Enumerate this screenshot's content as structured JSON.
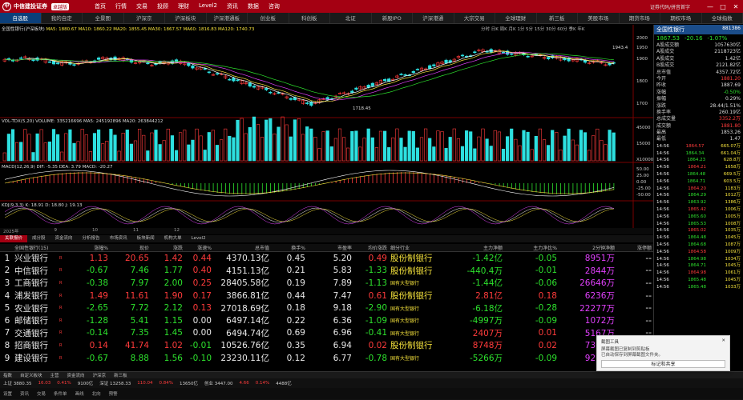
{
  "app": {
    "logo": "中信建投证券",
    "logo_sub": "CHINA SECURITIES",
    "edition": "卓越版",
    "menu": [
      "首页",
      "行情",
      "交易",
      "投顾",
      "理财",
      "Level2",
      "资讯",
      "数据",
      "咨询"
    ],
    "search": "证券代码/拼音首字"
  },
  "tabs": [
    "自选股",
    "我的自定",
    "全景图",
    "沪深京",
    "沪深板块",
    "沪深港通板",
    "创业板",
    "科创板",
    "北证",
    "新股IPO",
    "沪深港通",
    "大宗交易",
    "全球理财",
    "新三板",
    "美股市场",
    "期货市场",
    "期权市场",
    "全球指数"
  ],
  "chart": {
    "title": "全国性银行(沪深板块)",
    "ma_text": "MA5: 1880.67  MA10: 1860.22  MA20: 1855.45  MA30: 1867.57  MA60: 1816.83  MA120: 1740.73",
    "vol_text": "VOL-TDX(5,20) VOLUME: 335216696  MA5: 245192896  MA20: 263844212",
    "macd_text": "MACD(12,26,9) DIF: -5.35  DEA: 3.79  MACD: -20.27",
    "kdj_text": "KDJ(9,3,3) K: 18.91  D: 18.80  J: 19.13",
    "y_labels": [
      "2000",
      "1950",
      "1900",
      "1800",
      "1700"
    ],
    "vol_labels": [
      "45000",
      "15000",
      "X10000"
    ],
    "macd_labels": [
      "50.00",
      "25.00",
      "0.00",
      "-25.00",
      "-50.00"
    ],
    "x_labels": [
      "2025年",
      "9",
      "10",
      "11",
      "12"
    ],
    "low_label": "1718.45",
    "high_label": "1943.4",
    "toolbar": "分时  日K  周K  月K  1分  5分  15分  30分  60分  季K  年K"
  },
  "side": {
    "name": "全国性银行",
    "code": "881386",
    "price": "1867.53",
    "change": "-20.16",
    "pct": "-1.07%",
    "rows": [
      [
        "A股成交额",
        "1057630亿"
      ],
      [
        "A股成交",
        "2118723亿"
      ],
      [
        "A股成交",
        "1.42亿"
      ],
      [
        "B股成交",
        "2121.82亿"
      ],
      [
        "总市值",
        "4357.72亿"
      ],
      [
        "今开",
        "1881.20"
      ],
      [
        "昨收",
        "1887.69"
      ],
      [
        "涨幅",
        "-0.50%"
      ],
      [
        "振幅",
        "0.29%"
      ],
      [
        "涨跌",
        "28.44/1.51%"
      ],
      [
        "换手率",
        "260.19亿"
      ],
      [
        "总成交量",
        "3352.2万"
      ],
      [
        "成交额",
        "1881.80"
      ],
      [
        "最高",
        "1853.26"
      ],
      [
        "最低",
        "1.47"
      ]
    ],
    "ticks": [
      [
        "14:56",
        "1864.57",
        "665.07万"
      ],
      [
        "14:56",
        "1864.34",
        "661.04万"
      ],
      [
        "14:56",
        "1864.23",
        "628.8万"
      ],
      [
        "14:56",
        "1864.21",
        "1658万"
      ],
      [
        "14:56",
        "1864.48",
        "669.5万"
      ],
      [
        "14:56",
        "1864.71",
        "603.5万"
      ],
      [
        "14:56",
        "1864.20",
        "1183万"
      ],
      [
        "14:56",
        "1864.29",
        "1012万"
      ],
      [
        "14:56",
        "1863.92",
        "1386万"
      ],
      [
        "14:56",
        "1865.42",
        "1006万"
      ],
      [
        "14:56",
        "1865.60",
        "1005万"
      ],
      [
        "14:56",
        "1865.53",
        "1008万"
      ],
      [
        "14:56",
        "1865.02",
        "1035万"
      ],
      [
        "14:56",
        "1864.48",
        "1045万"
      ],
      [
        "14:56",
        "1864.68",
        "1087万"
      ],
      [
        "14:56",
        "1864.58",
        "1009万"
      ],
      [
        "14:56",
        "1864.98",
        "1034万"
      ],
      [
        "14:56",
        "1864.71",
        "1045万"
      ],
      [
        "14:56",
        "1864.98",
        "1061万"
      ],
      [
        "14:56",
        "1865.48",
        "1045万"
      ],
      [
        "14:56",
        "1865.48",
        "1033万"
      ]
    ]
  },
  "midstrip": [
    "2025年",
    "9",
    "10",
    "11",
    "12"
  ],
  "subtabs": [
    "关联报价",
    "成分股",
    "资金流向",
    "分析报告",
    "市场资讯",
    "板块新闻",
    "机构大单",
    "Level2"
  ],
  "table": {
    "headers": [
      "",
      "全国性银行(15)",
      "",
      "涨幅%",
      "现价",
      "涨跌",
      "涨速%",
      "总市值",
      "换手%",
      "市盈率",
      "均价涨跌",
      "细分行业",
      "主力净额",
      "主力净比%",
      "2分钟净额",
      "涨停额"
    ],
    "rows": [
      [
        "1",
        "兴业银行",
        "R",
        "1.13",
        "20.65",
        "1.42",
        "0.44",
        "4370.13亿",
        "0.45",
        "5.20",
        "0.49",
        "股份制银行",
        "-1.42亿",
        "-0.05",
        "8951万",
        "--"
      ],
      [
        "2",
        "中信银行",
        "R",
        "-0.67",
        "7.46",
        "1.77",
        "0.40",
        "4151.13亿",
        "0.21",
        "5.83",
        "-1.33",
        "股份制银行",
        "-440.4万",
        "-0.01",
        "2844万",
        "--"
      ],
      [
        "3",
        "工商银行",
        "R",
        "-0.38",
        "7.97",
        "2.00",
        "0.25",
        "28405.58亿",
        "0.19",
        "7.89",
        "-1.13",
        "国有大型银行",
        "-1.44亿",
        "-0.06",
        "26646万",
        "--"
      ],
      [
        "4",
        "浦发银行",
        "R",
        "1.49",
        "11.61",
        "1.90",
        "0.17",
        "3866.81亿",
        "0.44",
        "7.47",
        "0.61",
        "股份制银行",
        "2.81亿",
        "0.18",
        "6236万",
        "--"
      ],
      [
        "5",
        "农业银行",
        "R",
        "-2.65",
        "7.72",
        "2.12",
        "0.13",
        "27018.69亿",
        "0.18",
        "9.18",
        "-2.90",
        "国有大型银行",
        "-6.18亿",
        "-0.28",
        "22277万",
        "--"
      ],
      [
        "6",
        "邮储银行",
        "R",
        "-1.28",
        "5.41",
        "1.15",
        "0.00",
        "6497.14亿",
        "0.22",
        "6.36",
        "-1.09",
        "国有大型银行",
        "-4997万",
        "-0.09",
        "1072万",
        "--"
      ],
      [
        "7",
        "交通银行",
        "R",
        "-0.14",
        "7.35",
        "1.45",
        "0.00",
        "6494.74亿",
        "0.69",
        "6.96",
        "-0.41",
        "国有大型银行",
        "2407万",
        "0.01",
        "5167万",
        "--"
      ],
      [
        "8",
        "招商银行",
        "R",
        "0.14",
        "41.74",
        "1.02",
        "-0.01",
        "10526.76亿",
        "0.35",
        "6.94",
        "0.02",
        "股份制银行",
        "8748万",
        "0.02",
        "7365万",
        "--"
      ],
      [
        "9",
        "建设银行",
        "R",
        "-0.67",
        "8.88",
        "1.56",
        "-0.10",
        "23230.11亿",
        "0.12",
        "6.77",
        "-0.78",
        "国有大型银行",
        "-5266万",
        "-0.09",
        "9215万",
        "--"
      ]
    ]
  },
  "status": {
    "row1": [
      "指数",
      "自定义板块",
      "主营",
      "资金流向",
      "沪深京",
      "新三板"
    ],
    "row2": [
      "上证 3880.35",
      "16.03",
      "0.41%",
      "9100亿",
      "深证 13258.33",
      "110.04",
      "0.84%",
      "13650亿",
      "创业 3447.00",
      "4.66",
      "0.14%",
      "4488亿"
    ],
    "row3": [
      "设置",
      "资讯",
      "交易",
      "条件单",
      "画线",
      "北向",
      "预警"
    ]
  },
  "toast": {
    "title": "截图工具",
    "msg1": "屏幕截图已复制到剪贴板",
    "msg2": "已自动保存到屏幕截图文件夹。",
    "btn": "标记和共享"
  },
  "colors": {
    "up": "#ff3b3b",
    "down": "#2de02d",
    "accent": "#a40012",
    "ma5": "#ffffff",
    "ma10": "#f5e23c",
    "ma20": "#e040fb",
    "ma30": "#2de02d"
  }
}
